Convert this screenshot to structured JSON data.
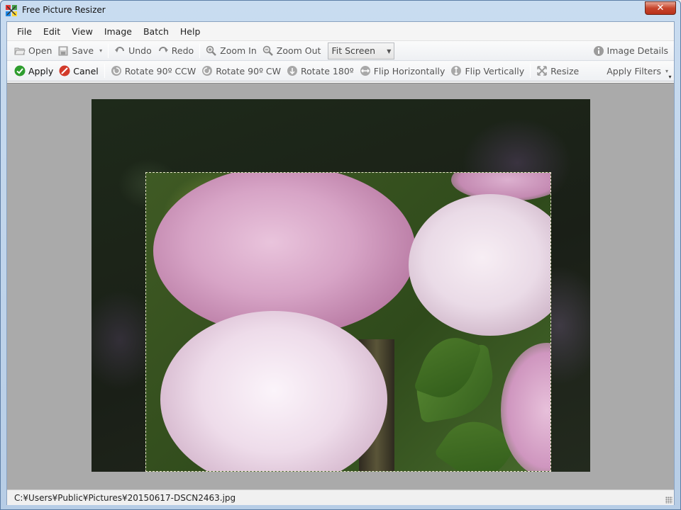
{
  "window": {
    "title": "Free Picture Resizer",
    "close_label": "✕"
  },
  "menu": [
    "File",
    "Edit",
    "View",
    "Image",
    "Batch",
    "Help"
  ],
  "toolbar1": {
    "open": "Open",
    "save": "Save",
    "undo": "Undo",
    "redo": "Redo",
    "zoom_in": "Zoom In",
    "zoom_out": "Zoom Out",
    "zoom_mode": "Fit Screen",
    "image_details": "Image Details"
  },
  "toolbar2": {
    "apply": "Apply",
    "cancel": "Canel",
    "rotate_ccw": "Rotate 90º CCW",
    "rotate_cw": "Rotate 90º CW",
    "rotate_180": "Rotate 180º",
    "flip_h": "Flip Horizontally",
    "flip_v": "Flip Vertically",
    "resize": "Resize",
    "apply_filters": "Apply Filters"
  },
  "status": {
    "path": "C:¥Users¥Public¥Pictures¥20150617-DSCN2463.jpg"
  },
  "colors": {
    "apply_green": "#2e9d2e",
    "cancel_red": "#d23a2a",
    "canvas_gray": "#aaaaaa"
  }
}
